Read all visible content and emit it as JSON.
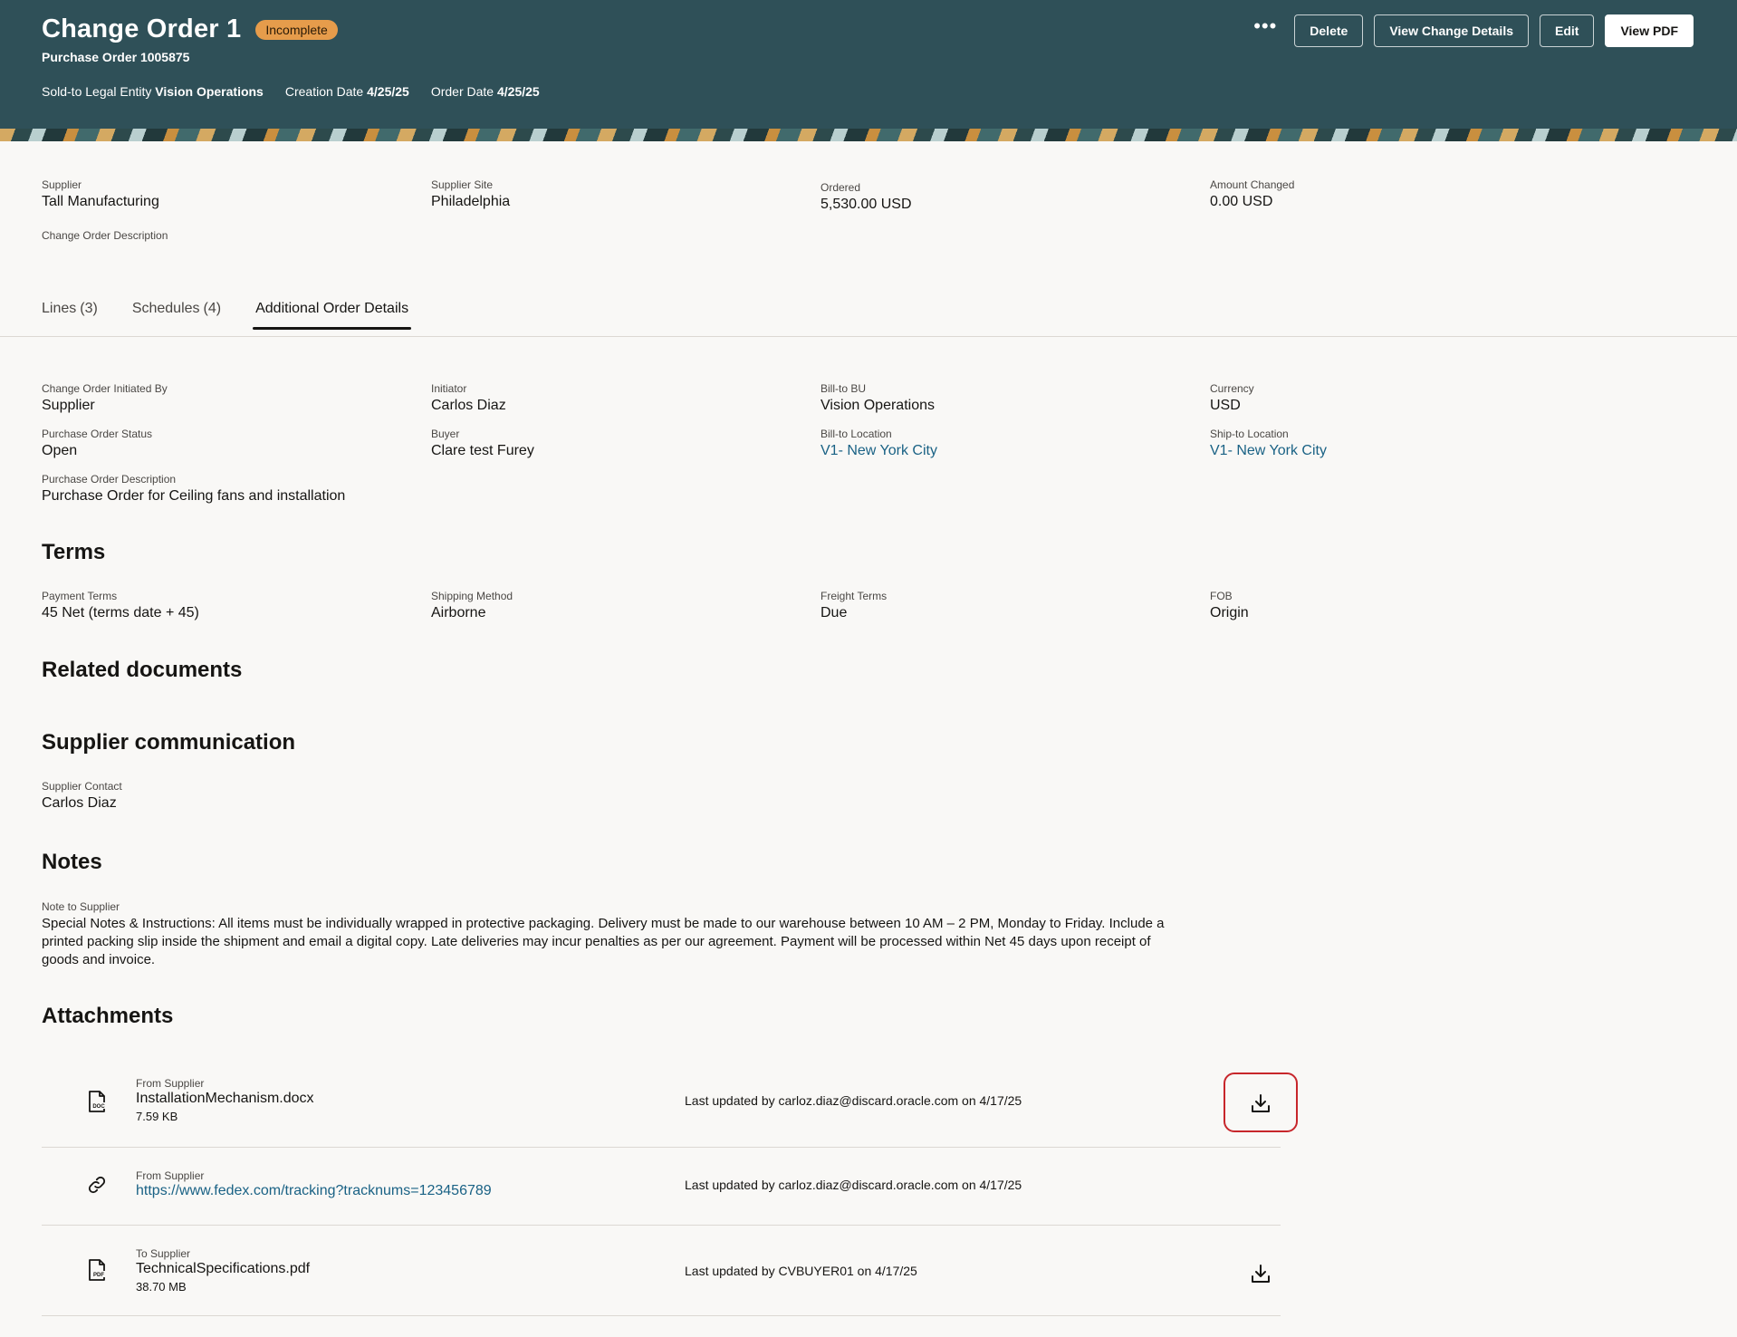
{
  "header": {
    "title": "Change Order 1",
    "status": "Incomplete",
    "subtitle": "Purchase Order 1005875",
    "meta": [
      {
        "label": "Sold-to Legal Entity",
        "value": "Vision Operations"
      },
      {
        "label": "Creation Date",
        "value": "4/25/25"
      },
      {
        "label": "Order Date",
        "value": "4/25/25"
      }
    ],
    "actions": {
      "more": "•••",
      "delete": "Delete",
      "view_change_details": "View Change Details",
      "edit": "Edit",
      "view_pdf": "View PDF"
    }
  },
  "summary": {
    "supplier": {
      "label": "Supplier",
      "value": "Tall Manufacturing"
    },
    "supplier_site": {
      "label": "Supplier Site",
      "value": "Philadelphia"
    },
    "ordered": {
      "label": "Ordered",
      "value": "5,530.00 USD"
    },
    "amount_changed": {
      "label": "Amount Changed",
      "value": "0.00 USD"
    },
    "description": {
      "label": "Change Order Description",
      "value": ""
    }
  },
  "tabs": [
    {
      "label": "Lines",
      "count": "(3)"
    },
    {
      "label": "Schedules",
      "count": "(4)"
    },
    {
      "label": "Additional Order Details",
      "count": ""
    }
  ],
  "details": {
    "initiated_by": {
      "label": "Change Order Initiated By",
      "value": "Supplier"
    },
    "initiator": {
      "label": "Initiator",
      "value": "Carlos Diaz"
    },
    "bill_to_bu": {
      "label": "Bill-to BU",
      "value": "Vision Operations"
    },
    "currency": {
      "label": "Currency",
      "value": "USD"
    },
    "po_status": {
      "label": "Purchase Order Status",
      "value": "Open"
    },
    "buyer": {
      "label": "Buyer",
      "value": "Clare test Furey"
    },
    "bill_to_location": {
      "label": "Bill-to Location",
      "value": "V1- New York City"
    },
    "ship_to_location": {
      "label": "Ship-to Location",
      "value": "V1- New York City"
    },
    "po_description": {
      "label": "Purchase Order Description",
      "value": "Purchase Order for Ceiling fans and installation"
    }
  },
  "terms": {
    "heading": "Terms",
    "payment_terms": {
      "label": "Payment Terms",
      "value": "45 Net (terms date + 45)"
    },
    "shipping_method": {
      "label": "Shipping Method",
      "value": "Airborne"
    },
    "freight_terms": {
      "label": "Freight Terms",
      "value": "Due"
    },
    "fob": {
      "label": "FOB",
      "value": "Origin"
    }
  },
  "related": {
    "heading": "Related documents"
  },
  "supplier_comm": {
    "heading": "Supplier communication",
    "contact": {
      "label": "Supplier Contact",
      "value": "Carlos Diaz"
    }
  },
  "notes": {
    "heading": "Notes",
    "label": "Note to Supplier",
    "text": "Special Notes & Instructions: All items must be individually wrapped in protective packaging. Delivery must be made to our warehouse between 10 AM – 2 PM, Monday to Friday. Include a printed packing slip inside the shipment and email a digital copy. Late deliveries may incur penalties as per our agreement. Payment will be processed within Net 45 days upon receipt of goods and invoice."
  },
  "attachments": {
    "heading": "Attachments",
    "items": [
      {
        "source": "From Supplier",
        "name": "InstallationMechanism.docx",
        "size": "7.59 KB",
        "updated": "Last updated by carloz.diaz@discard.oracle.com on 4/17/25",
        "icon": "doc-file-icon",
        "icon_text": "DOC"
      },
      {
        "source": "From Supplier",
        "name": "https://www.fedex.com/tracking?tracknums=123456789",
        "size": "",
        "updated": "Last updated by carloz.diaz@discard.oracle.com on 4/17/25",
        "icon": "link-icon"
      },
      {
        "source": "To Supplier",
        "name": "TechnicalSpecifications.pdf",
        "size": "38.70 MB",
        "updated": "Last updated by CVBUYER01 on 4/17/25",
        "icon": "pdf-file-icon",
        "icon_text": "PDF"
      }
    ]
  },
  "colors": {
    "header_bg": "#2f5058",
    "badge_bg": "#e69c4b",
    "link": "#1a6285",
    "highlight": "#c7262b"
  }
}
